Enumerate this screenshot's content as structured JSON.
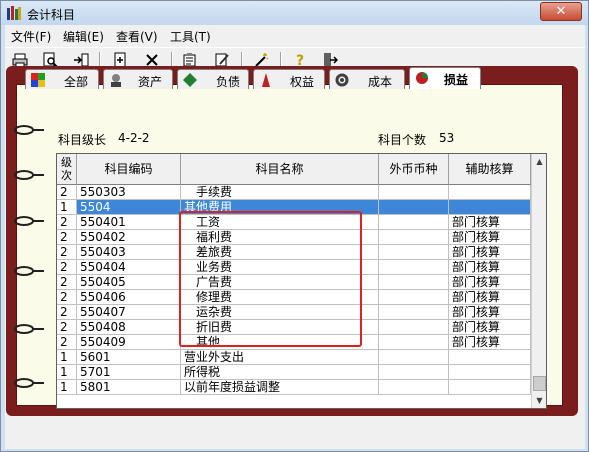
{
  "window": {
    "title": "会计科目",
    "close_label": "✕"
  },
  "menu": [
    "文件(F)",
    "编辑(E)",
    "查看(V)",
    "工具(T)"
  ],
  "toolbar": [
    {
      "label": "打印",
      "icon": "printer-icon"
    },
    {
      "label": "预览",
      "icon": "preview-icon"
    },
    {
      "label": "输出",
      "icon": "export-icon"
    },
    {
      "label": "增加",
      "icon": "add-icon"
    },
    {
      "label": "删除",
      "icon": "delete-icon"
    },
    {
      "label": "查找",
      "icon": "find-icon"
    },
    {
      "label": "修改",
      "icon": "edit-icon"
    },
    {
      "label": "定义",
      "icon": "define-icon"
    },
    {
      "label": "帮助",
      "icon": "help-icon"
    },
    {
      "label": "退出",
      "icon": "exit-icon"
    }
  ],
  "tabs": [
    {
      "label": "全部",
      "icon": "all-icon"
    },
    {
      "label": "资产",
      "icon": "assets-icon"
    },
    {
      "label": "负债",
      "icon": "liabilities-icon"
    },
    {
      "label": "权益",
      "icon": "equity-icon"
    },
    {
      "label": "成本",
      "icon": "cost-icon"
    },
    {
      "label": "损益",
      "icon": "profit-loss-icon"
    }
  ],
  "info": {
    "level_label": "科目级长",
    "level_value": "4-2-2",
    "count_label": "科目个数",
    "count_value": "53"
  },
  "columns": {
    "level": "级次",
    "code": "科目编码",
    "name": "科目名称",
    "currency": "外币币种",
    "aux": "辅助核算"
  },
  "rows": [
    {
      "level": "2",
      "code": "550303",
      "name": "手续费",
      "aux": ""
    },
    {
      "level": "1",
      "code": "5504",
      "name": "其他费用",
      "aux": "",
      "selected": true
    },
    {
      "level": "2",
      "code": "550401",
      "name": "工资",
      "aux": "部门核算"
    },
    {
      "level": "2",
      "code": "550402",
      "name": "福利费",
      "aux": "部门核算"
    },
    {
      "level": "2",
      "code": "550403",
      "name": "差旅费",
      "aux": "部门核算"
    },
    {
      "level": "2",
      "code": "550404",
      "name": "业务费",
      "aux": "部门核算"
    },
    {
      "level": "2",
      "code": "550405",
      "name": "广告费",
      "aux": "部门核算"
    },
    {
      "level": "2",
      "code": "550406",
      "name": "修理费",
      "aux": "部门核算"
    },
    {
      "level": "2",
      "code": "550407",
      "name": "运杂费",
      "aux": "部门核算"
    },
    {
      "level": "2",
      "code": "550408",
      "name": "折旧费",
      "aux": "部门核算"
    },
    {
      "level": "2",
      "code": "550409",
      "name": "其他",
      "aux": "部门核算"
    },
    {
      "level": "1",
      "code": "5601",
      "name": "营业外支出",
      "aux": ""
    },
    {
      "level": "1",
      "code": "5701",
      "name": "所得税",
      "aux": ""
    },
    {
      "level": "1",
      "code": "5801",
      "name": "以前年度损益调整",
      "aux": ""
    }
  ],
  "colors": {
    "selection": "#3d86d8",
    "highlight": "#e02020",
    "book": "#7a1d1d",
    "page": "#fbfbe9"
  }
}
